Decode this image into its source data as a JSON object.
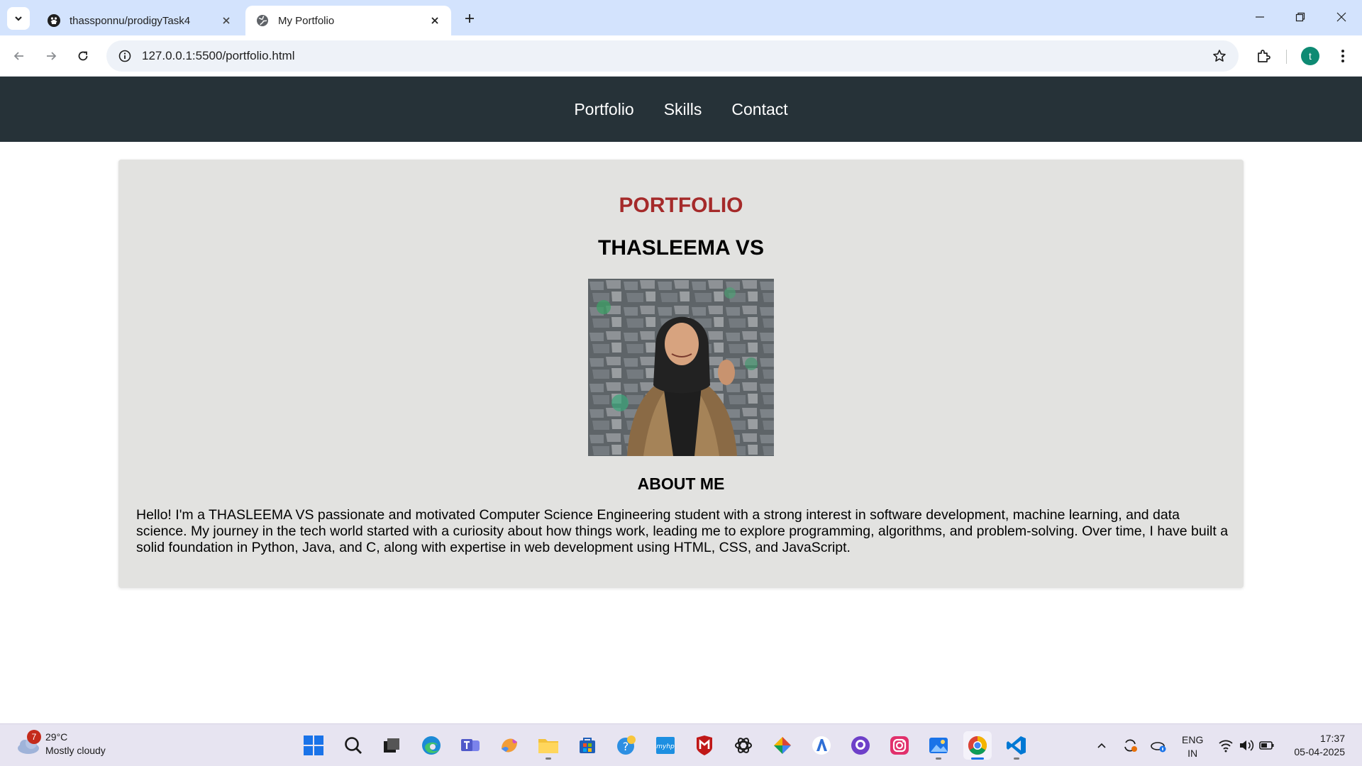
{
  "browser": {
    "tabs": [
      {
        "title": "thassponnu/prodigyTask4",
        "favicon": "github-icon",
        "active": false
      },
      {
        "title": "My Portfolio",
        "favicon": "globe-icon",
        "active": true
      }
    ],
    "url": "127.0.0.1:5500/portfolio.html",
    "profile_initial": "t"
  },
  "site": {
    "nav": [
      "Portfolio",
      "Skills",
      "Contact"
    ],
    "portfolio_title": "PORTFOLIO",
    "name": "THASLEEMA VS",
    "about_heading": "ABOUT ME",
    "about_text": "Hello! I'm a THASLEEMA VS passionate and motivated Computer Science Engineering student with a strong interest in software development, machine learning, and data science. My journey in the tech world started with a curiosity about how things work, leading me to explore programming, algorithms, and problem-solving. Over time, I have built a solid foundation in Python, Java, and C, along with expertise in web development using HTML, CSS, and JavaScript.",
    "colors": {
      "nav_bg": "#263238",
      "card_bg": "#e2e2e0",
      "title_color": "#a52a2a"
    }
  },
  "taskbar": {
    "weather": {
      "temp": "29°C",
      "condition": "Mostly cloudy",
      "badge": "7"
    },
    "apps": [
      "start-icon",
      "search-icon",
      "task-view-icon",
      "edge-icon",
      "teams-icon",
      "copilot-icon",
      "file-explorer-icon",
      "store-icon",
      "help-icon",
      "myhp-icon",
      "mcafee-icon",
      "chatgpt-icon",
      "gemini-icon",
      "azure-icon",
      "github-desktop-icon",
      "instagram-icon",
      "photos-icon",
      "chrome-icon",
      "vscode-icon"
    ],
    "lang": {
      "line1": "ENG",
      "line2": "IN"
    },
    "time": "17:37",
    "date": "05-04-2025"
  }
}
